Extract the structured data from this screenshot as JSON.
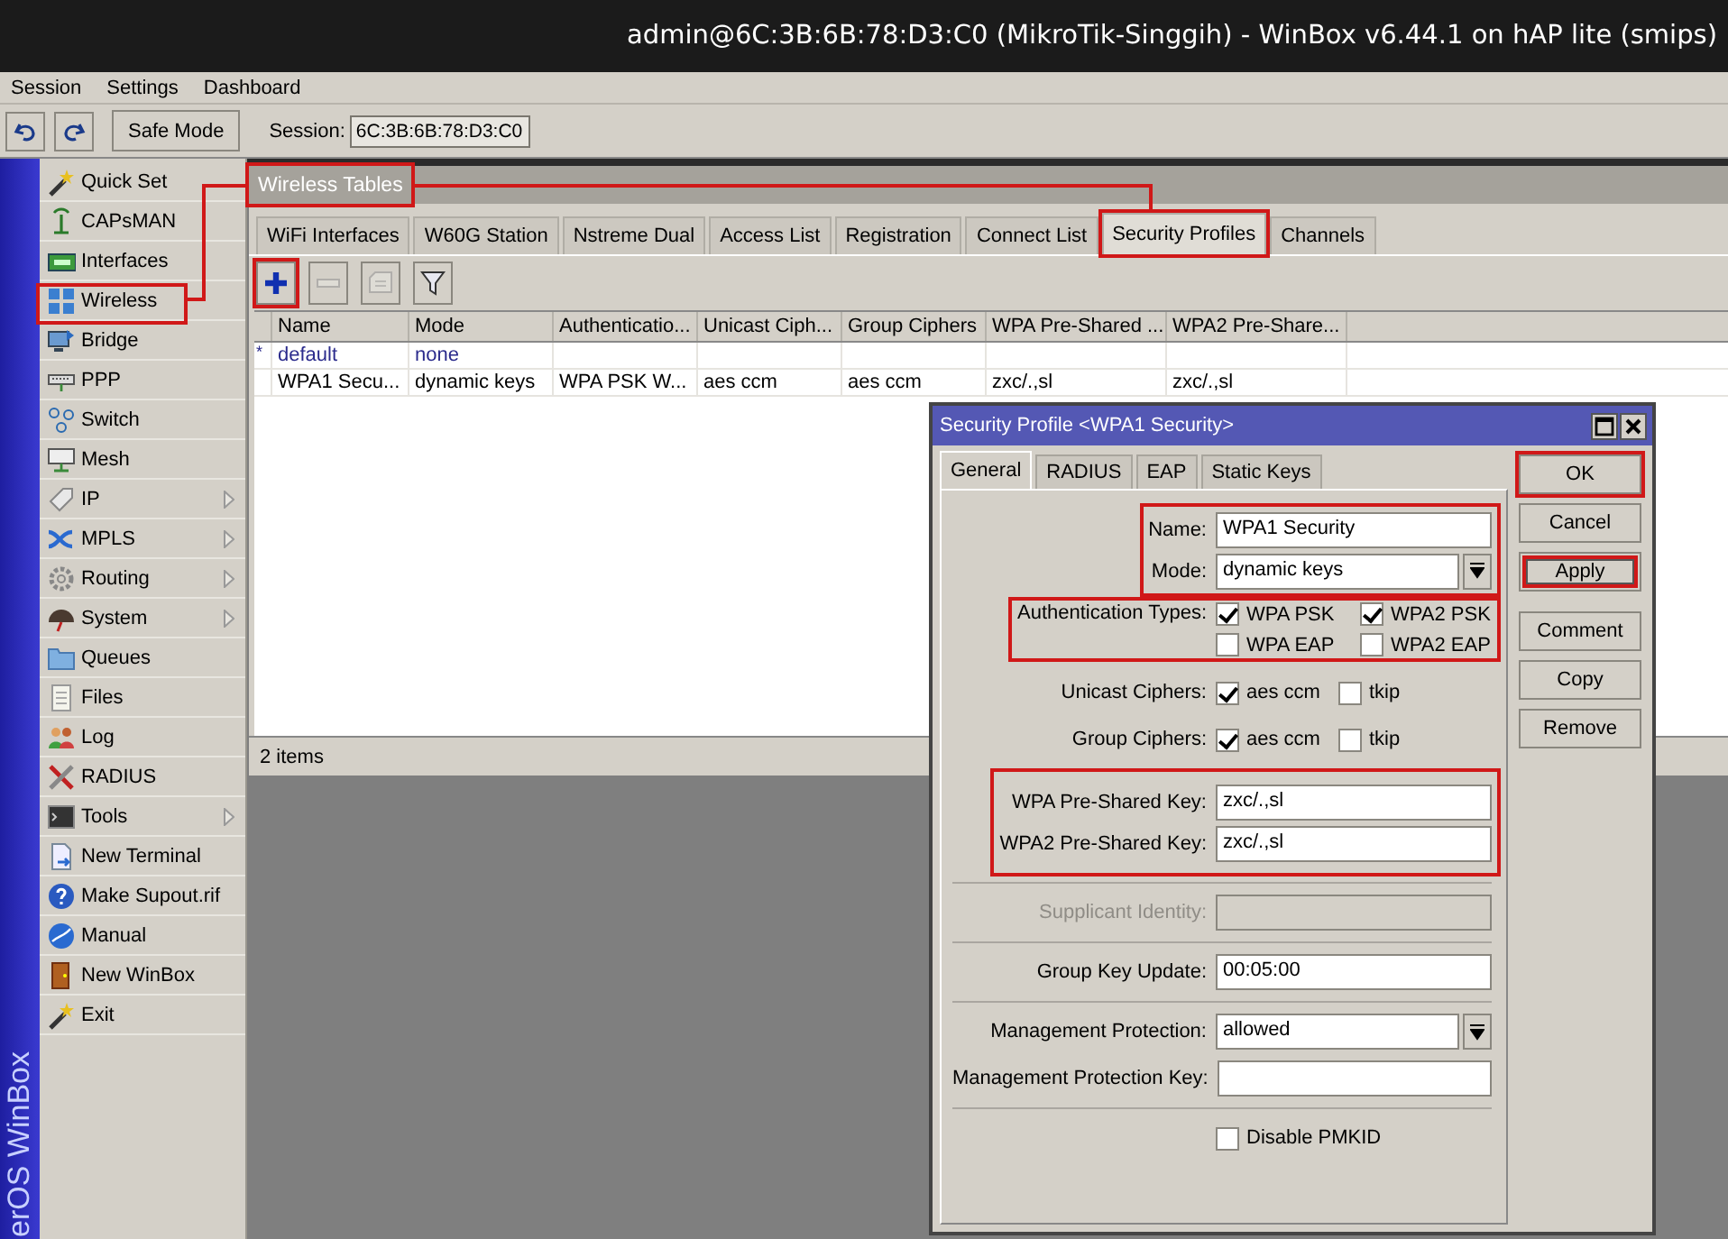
{
  "window": {
    "title": "admin@6C:3B:6B:78:D3:C0 (MikroTik-Singgih) - WinBox v6.44.1 on hAP lite (smips)"
  },
  "menu": [
    "Session",
    "Settings",
    "Dashboard"
  ],
  "toolbar": {
    "safe_mode": "Safe Mode",
    "session_label": "Session:",
    "session_value": "6C:3B:6B:78:D3:C0"
  },
  "brand": "erOS WinBox",
  "sidebar": {
    "items": [
      {
        "label": "Quick Set",
        "submenu": false,
        "highlighted": false
      },
      {
        "label": "CAPsMAN",
        "submenu": false,
        "highlighted": false
      },
      {
        "label": "Interfaces",
        "submenu": false,
        "highlighted": false
      },
      {
        "label": "Wireless",
        "submenu": false,
        "highlighted": true
      },
      {
        "label": "Bridge",
        "submenu": false,
        "highlighted": false
      },
      {
        "label": "PPP",
        "submenu": false,
        "highlighted": false
      },
      {
        "label": "Switch",
        "submenu": false,
        "highlighted": false
      },
      {
        "label": "Mesh",
        "submenu": false,
        "highlighted": false
      },
      {
        "label": "IP",
        "submenu": true,
        "highlighted": false
      },
      {
        "label": "MPLS",
        "submenu": true,
        "highlighted": false
      },
      {
        "label": "Routing",
        "submenu": true,
        "highlighted": false
      },
      {
        "label": "System",
        "submenu": true,
        "highlighted": false
      },
      {
        "label": "Queues",
        "submenu": false,
        "highlighted": false
      },
      {
        "label": "Files",
        "submenu": false,
        "highlighted": false
      },
      {
        "label": "Log",
        "submenu": false,
        "highlighted": false
      },
      {
        "label": "RADIUS",
        "submenu": false,
        "highlighted": false
      },
      {
        "label": "Tools",
        "submenu": true,
        "highlighted": false
      },
      {
        "label": "New Terminal",
        "submenu": false,
        "highlighted": false
      },
      {
        "label": "Make Supout.rif",
        "submenu": false,
        "highlighted": false
      },
      {
        "label": "Manual",
        "submenu": false,
        "highlighted": false
      },
      {
        "label": "New WinBox",
        "submenu": false,
        "highlighted": false
      },
      {
        "label": "Exit",
        "submenu": false,
        "highlighted": false
      }
    ]
  },
  "tables_window": {
    "title": "Wireless Tables",
    "title_highlighted": true,
    "tabs": [
      {
        "label": "WiFi Interfaces",
        "selected": false,
        "highlighted": false
      },
      {
        "label": "W60G Station",
        "selected": false,
        "highlighted": false
      },
      {
        "label": "Nstreme Dual",
        "selected": false,
        "highlighted": false
      },
      {
        "label": "Access List",
        "selected": false,
        "highlighted": false
      },
      {
        "label": "Registration",
        "selected": false,
        "highlighted": false
      },
      {
        "label": "Connect List",
        "selected": false,
        "highlighted": false
      },
      {
        "label": "Security Profiles",
        "selected": true,
        "highlighted": true
      },
      {
        "label": "Channels",
        "selected": false,
        "highlighted": false
      }
    ],
    "tools": [
      {
        "kind": "add",
        "disabled": false,
        "highlighted": true
      },
      {
        "kind": "remove",
        "disabled": true,
        "highlighted": false
      },
      {
        "kind": "comment",
        "disabled": true,
        "highlighted": false
      },
      {
        "kind": "filter",
        "disabled": false,
        "highlighted": false
      }
    ],
    "columns": [
      "Name",
      "Mode",
      "Authenticatio...",
      "Unicast Ciph...",
      "Group Ciphers",
      "WPA Pre-Shared ...",
      "WPA2 Pre-Share..."
    ],
    "rows": [
      {
        "flag": "*",
        "default": true,
        "cells": [
          "default",
          "none",
          "",
          "",
          "",
          "",
          ""
        ]
      },
      {
        "default": false,
        "cells": [
          "WPA1 Secu...",
          "dynamic keys",
          "WPA PSK W...",
          "aes ccm",
          "aes ccm",
          "zxc/.,sl",
          "zxc/.,sl"
        ]
      }
    ],
    "status": "2 items"
  },
  "dialog": {
    "title": "Security Profile <WPA1 Security>",
    "tabs": [
      {
        "label": "General",
        "selected": true
      },
      {
        "label": "RADIUS",
        "selected": false
      },
      {
        "label": "EAP",
        "selected": false
      },
      {
        "label": "Static Keys",
        "selected": false
      }
    ],
    "blocks": [
      {
        "divider": false,
        "highlighted": true,
        "rows": [
          {
            "kind": "text",
            "label": "Name:",
            "value": "WPA1 Security"
          },
          {
            "kind": "select",
            "label": "Mode:",
            "value": "dynamic keys"
          }
        ]
      },
      {
        "divider": false,
        "highlighted": true,
        "rows": [
          {
            "kind": "checks",
            "label": "Authentication Types:",
            "options": [
              {
                "label": "WPA PSK",
                "checked": true
              },
              {
                "label": "WPA2 PSK",
                "checked": true
              },
              {
                "label": "WPA EAP",
                "checked": false
              },
              {
                "label": "WPA2 EAP",
                "checked": false
              }
            ]
          }
        ]
      },
      {
        "divider": false,
        "highlighted": false,
        "rows": [
          {
            "kind": "checks",
            "label": "Unicast Ciphers:",
            "options": [
              {
                "label": "aes ccm",
                "checked": true
              },
              {
                "label": "tkip",
                "checked": false
              }
            ]
          },
          {
            "kind": "checks",
            "label": "Group Ciphers:",
            "options": [
              {
                "label": "aes ccm",
                "checked": true
              },
              {
                "label": "tkip",
                "checked": false
              }
            ]
          }
        ]
      },
      {
        "divider": true,
        "highlighted": true,
        "rows": [
          {
            "kind": "text",
            "label": "WPA Pre-Shared Key:",
            "value": "zxc/.,sl"
          },
          {
            "kind": "text",
            "label": "WPA2 Pre-Shared Key:",
            "value": "zxc/.,sl"
          }
        ]
      },
      {
        "divider": true,
        "highlighted": false,
        "rows": [
          {
            "kind": "text",
            "label": "Supplicant Identity:",
            "disabled": true
          }
        ]
      },
      {
        "divider": true,
        "highlighted": false,
        "rows": [
          {
            "kind": "text",
            "label": "Group Key Update:",
            "value": "00:05:00"
          }
        ]
      },
      {
        "divider": true,
        "highlighted": false,
        "rows": [
          {
            "kind": "select",
            "label": "Management Protection:",
            "value": "allowed"
          },
          {
            "kind": "text",
            "label": "Management Protection Key:"
          }
        ]
      },
      {
        "divider": true,
        "highlighted": false,
        "rows": [
          {
            "kind": "check",
            "label": "Disable PMKID",
            "checked": false
          }
        ]
      }
    ],
    "buttons": [
      {
        "label": "OK",
        "highlighted": true,
        "focused": false
      },
      {
        "label": "Cancel",
        "highlighted": false,
        "focused": false
      },
      {
        "label": "Apply",
        "highlighted": true,
        "focused": true
      },
      {
        "label": "Comment",
        "highlighted": false,
        "focused": false
      },
      {
        "label": "Copy",
        "highlighted": false,
        "focused": false
      },
      {
        "label": "Remove",
        "highlighted": false,
        "focused": false
      }
    ]
  }
}
